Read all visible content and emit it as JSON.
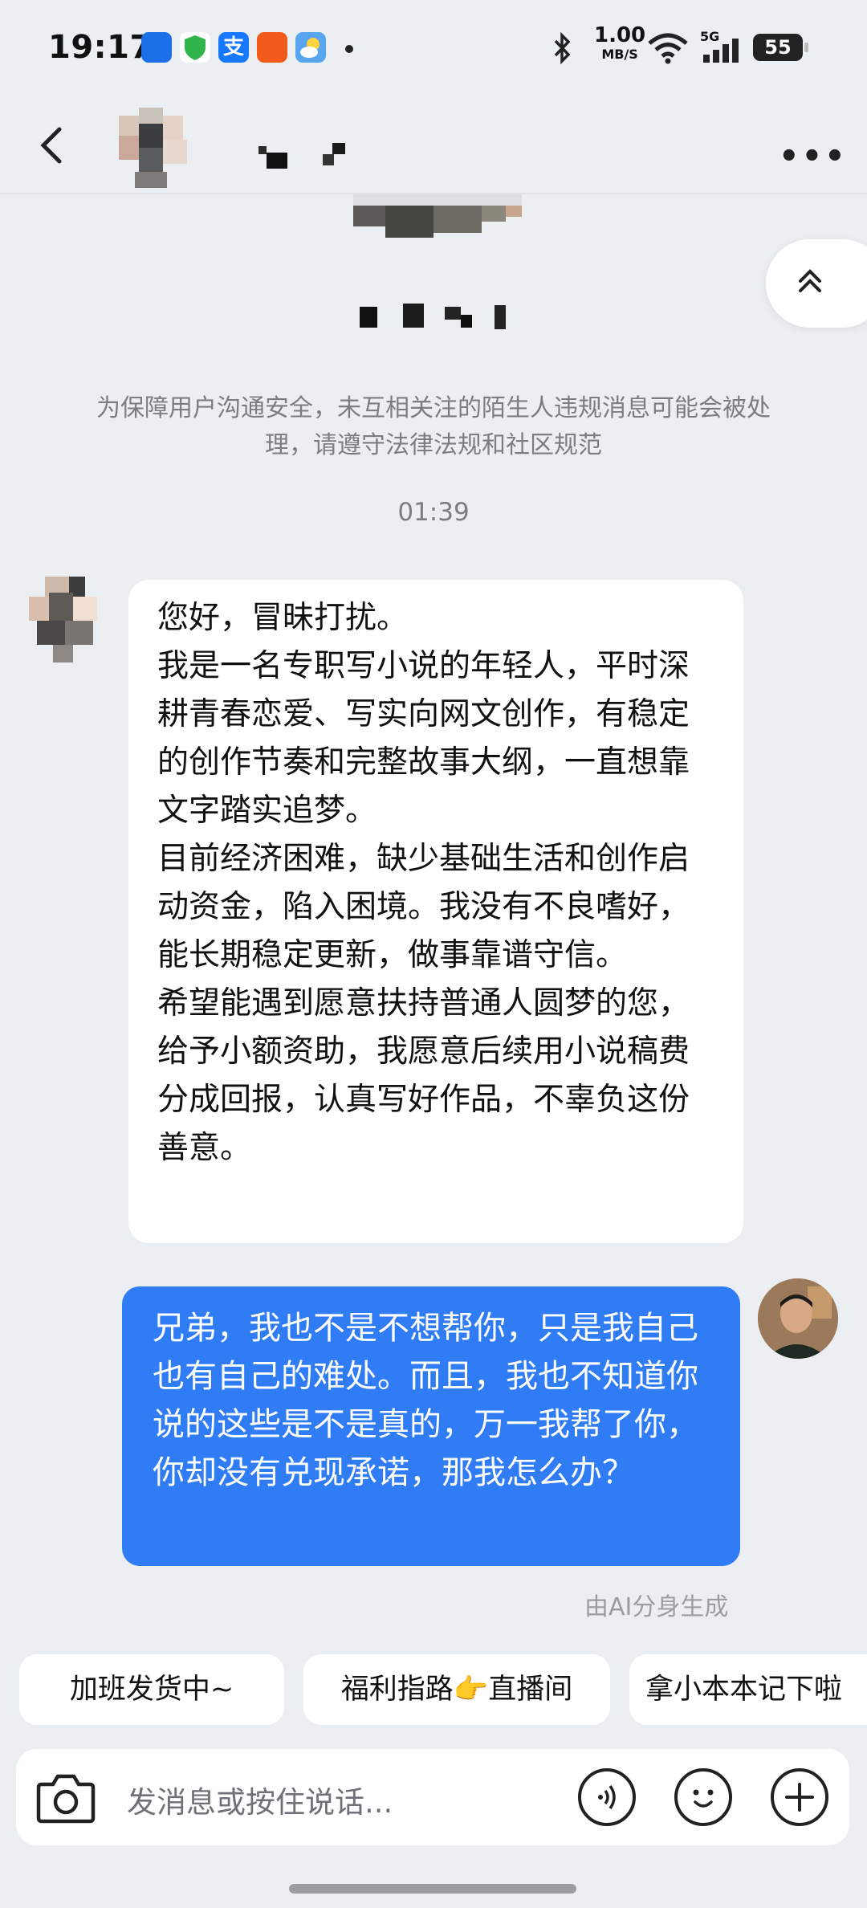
{
  "status_bar": {
    "time": "19:17",
    "net_speed_value": "1.00",
    "net_speed_unit": "MB/S",
    "signal": "5G",
    "battery": "55"
  },
  "header": {
    "back_icon": "chevron-left-icon",
    "more_icon": "more-dots-icon"
  },
  "notice": "为保障用户沟通安全，未互相关注的陌生人违规消息可能会被处理，请遵守法律法规和社区规范",
  "timestamp": "01:39",
  "messages": [
    {
      "direction": "incoming",
      "text": "您好，冒昧打扰。\n我是一名专职写小说的年轻人，平时深耕青春恋爱、写实向网文创作，有稳定的创作节奏和完整故事大纲，一直想靠文字踏实追梦。\n目前经济困难，缺少基础生活和创作启动资金，陷入困境。我没有不良嗜好，能长期稳定更新，做事靠谱守信。\n希望能遇到愿意扶持普通人圆梦的您，给予小额资助，我愿意后续用小说稿费分成回报，认真写好作品，不辜负这份善意。"
    },
    {
      "direction": "outgoing",
      "text": "兄弟，我也不是不想帮你，只是我自己也有自己的难处。而且，我也不知道你说的这些是不是真的，万一我帮了你，你却没有兑现承诺，那我怎么办？"
    }
  ],
  "ai_note": "由AI分身生成",
  "quick_replies": [
    "加班发货中~",
    "福利指路👉直播间",
    "拿小本本记下啦"
  ],
  "input": {
    "placeholder": "发消息或按住说话...",
    "icons": [
      "camera-icon",
      "voice-icon",
      "emoji-icon",
      "plus-icon"
    ]
  },
  "colors": {
    "background": "#eceff2",
    "outgoing_bubble": "#2f7cf5",
    "incoming_bubble": "#ffffff"
  }
}
